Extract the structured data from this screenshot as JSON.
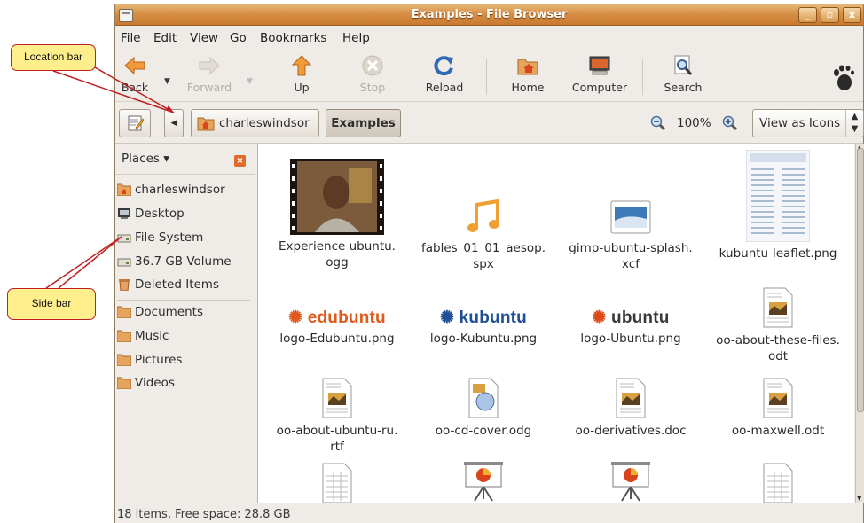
{
  "window": {
    "title": "Examples - File Browser",
    "controls": {
      "minimize": "_",
      "maximize": "▫",
      "close": "x"
    }
  },
  "menubar": {
    "items": [
      "File",
      "Edit",
      "View",
      "Go",
      "Bookmarks",
      "Help"
    ]
  },
  "toolbar": {
    "back": "Back",
    "forward": "Forward",
    "up": "Up",
    "stop": "Stop",
    "reload": "Reload",
    "home": "Home",
    "computer": "Computer",
    "search": "Search"
  },
  "location": {
    "crumbs": [
      "charleswindsor",
      "Examples"
    ],
    "zoom": "100%",
    "view_mode": "View as Icons"
  },
  "sidebar": {
    "header": "Places",
    "items": [
      "charleswindsor",
      "Desktop",
      "File System",
      "36.7 GB Volume",
      "Deleted Items"
    ],
    "bookmarks": [
      "Documents",
      "Music",
      "Pictures",
      "Videos"
    ]
  },
  "files": [
    {
      "name": "Experience ubuntu.\nogg",
      "icon": "video-thumbnail"
    },
    {
      "name": "fables_01_01_aesop.\nspx",
      "icon": "music-note-icon"
    },
    {
      "name": "gimp-ubuntu-splash.\nxcf",
      "icon": "image-icon"
    },
    {
      "name": "kubuntu-leaflet.png",
      "icon": "leaflet-thumbnail"
    },
    {
      "name": "logo-Edubuntu.png",
      "icon": "edubuntu-logo",
      "logo_text": "edubuntu"
    },
    {
      "name": "logo-Kubuntu.png",
      "icon": "kubuntu-logo",
      "logo_text": "kubuntu"
    },
    {
      "name": "logo-Ubuntu.png",
      "icon": "ubuntu-logo",
      "logo_text": "ubuntu"
    },
    {
      "name": "oo-about-these-files.\nodt",
      "icon": "document-icon"
    },
    {
      "name": "oo-about-ubuntu-ru.\nrtf",
      "icon": "document-icon"
    },
    {
      "name": "oo-cd-cover.odg",
      "icon": "drawing-icon"
    },
    {
      "name": "oo-derivatives.doc",
      "icon": "document-icon"
    },
    {
      "name": "oo-maxwell.odt",
      "icon": "document-icon"
    },
    {
      "name": "",
      "icon": "spreadsheet-icon"
    },
    {
      "name": "",
      "icon": "presentation-icon"
    },
    {
      "name": "",
      "icon": "presentation-icon"
    },
    {
      "name": "",
      "icon": "spreadsheet-icon"
    }
  ],
  "status": "18 items, Free space: 28.8 GB",
  "callouts": {
    "location_bar": "Location bar",
    "side_bar": "Side bar"
  },
  "colors": {
    "title_accent": "#d68f45",
    "callout_fill": "#ffee8c",
    "callout_border": "#c02020",
    "edubuntu": "#e05a1c",
    "kubuntu": "#1f5fae",
    "ubuntu": "#dd4814"
  }
}
